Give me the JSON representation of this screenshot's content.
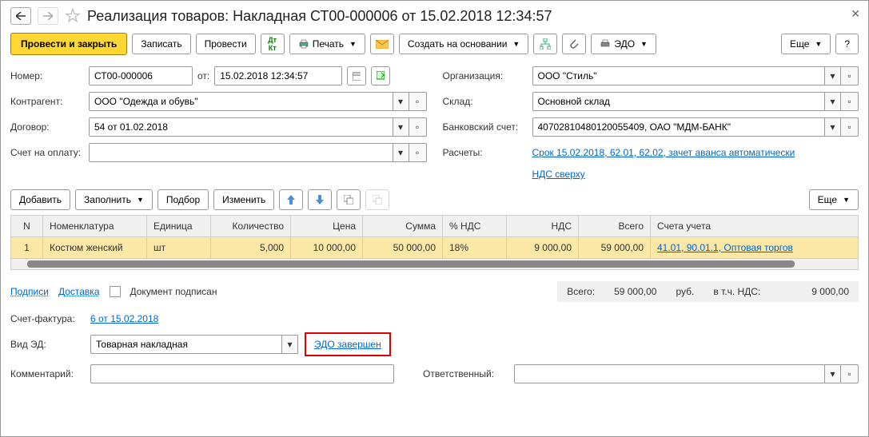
{
  "title": "Реализация товаров: Накладная СТ00-000006 от 15.02.2018 12:34:57",
  "toolbar": {
    "post_close": "Провести и закрыть",
    "save": "Записать",
    "post": "Провести",
    "print": "Печать",
    "create_based": "Создать на основании",
    "edo": "ЭДО",
    "more": "Еще",
    "help": "?"
  },
  "fields": {
    "number_lbl": "Номер:",
    "number": "СТ00-000006",
    "from_lbl": "от:",
    "date": "15.02.2018 12:34:57",
    "org_lbl": "Организация:",
    "org": "ООО \"Стиль\"",
    "counterparty_lbl": "Контрагент:",
    "counterparty": "ООО \"Одежда и обувь\"",
    "warehouse_lbl": "Склад:",
    "warehouse": "Основной склад",
    "contract_lbl": "Договор:",
    "contract": "54 от 01.02.2018",
    "bank_lbl": "Банковский счет:",
    "bank": "40702810480120055409, ОАО \"МДМ-БАНК\"",
    "invoice_lbl": "Счет на оплату:",
    "invoice": "",
    "settlements_lbl": "Расчеты:",
    "settlements_link": "Срок 15.02.2018, 62.01, 62.02, зачет аванса автоматически",
    "vat_link": "НДС сверху"
  },
  "tbl_toolbar": {
    "add": "Добавить",
    "fill": "Заполнить",
    "pick": "Подбор",
    "change": "Изменить",
    "more": "Еще"
  },
  "table": {
    "headers": {
      "n": "N",
      "nomen": "Номенклатура",
      "unit": "Единица",
      "qty": "Количество",
      "price": "Цена",
      "sum": "Сумма",
      "vat_pct": "% НДС",
      "vat": "НДС",
      "total": "Всего",
      "accounts": "Счета учета"
    },
    "rows": [
      {
        "n": "1",
        "nomen": "Костюм женский",
        "unit": "шт",
        "qty": "5,000",
        "price": "10 000,00",
        "sum": "50 000,00",
        "vat_pct": "18%",
        "vat": "9 000,00",
        "total": "59 000,00",
        "accounts": "41.01, 90.01.1, Оптовая торгов"
      }
    ]
  },
  "footer": {
    "signatures": "Подписи",
    "delivery": "Доставка",
    "signed": "Документ подписан",
    "total_lbl": "Всего:",
    "total": "59 000,00",
    "currency": "руб.",
    "vat_incl_lbl": "в т.ч. НДС:",
    "vat_incl": "9 000,00",
    "sf_lbl": "Счет-фактура:",
    "sf_link": "6 от 15.02.2018",
    "ed_type_lbl": "Вид ЭД:",
    "ed_type": "Товарная накладная",
    "edo_done": "ЭДО завершен",
    "comment_lbl": "Комментарий:",
    "responsible_lbl": "Ответственный:"
  }
}
